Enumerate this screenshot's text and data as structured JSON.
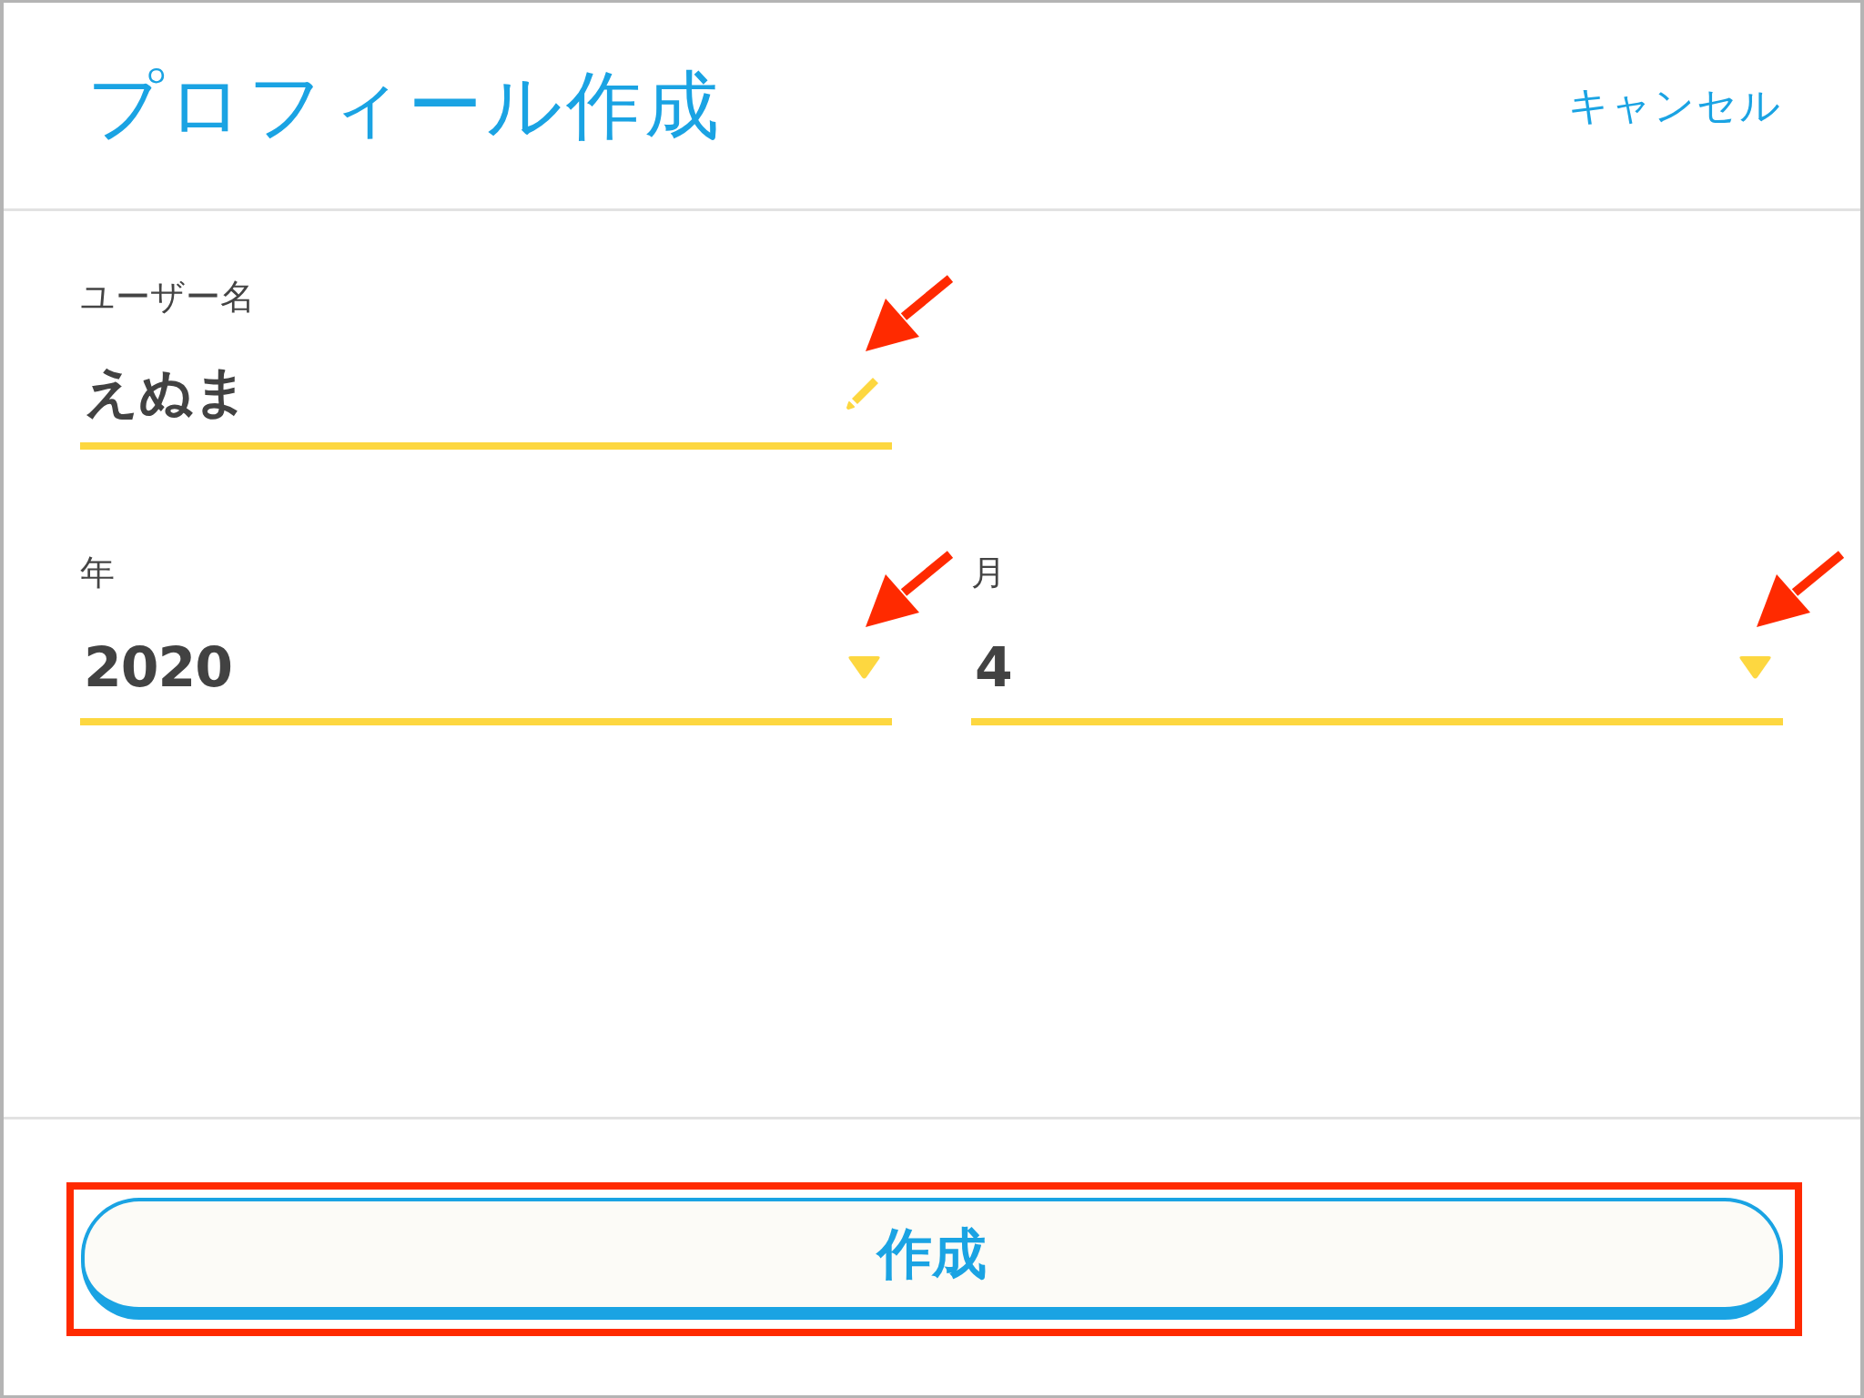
{
  "header": {
    "title": "プロフィール作成",
    "cancel": "キャンセル"
  },
  "form": {
    "rows": [
      [
        {
          "label": "ユーザー名",
          "value": "えぬま",
          "kind": "text",
          "callout_arrow": true
        }
      ],
      [
        {
          "label": "年",
          "value": "2020",
          "kind": "select",
          "callout_arrow": true
        },
        {
          "label": "月",
          "value": "4",
          "kind": "select",
          "callout_arrow": true
        }
      ]
    ]
  },
  "create_button": {
    "label": "作成",
    "callout_frame": true
  }
}
